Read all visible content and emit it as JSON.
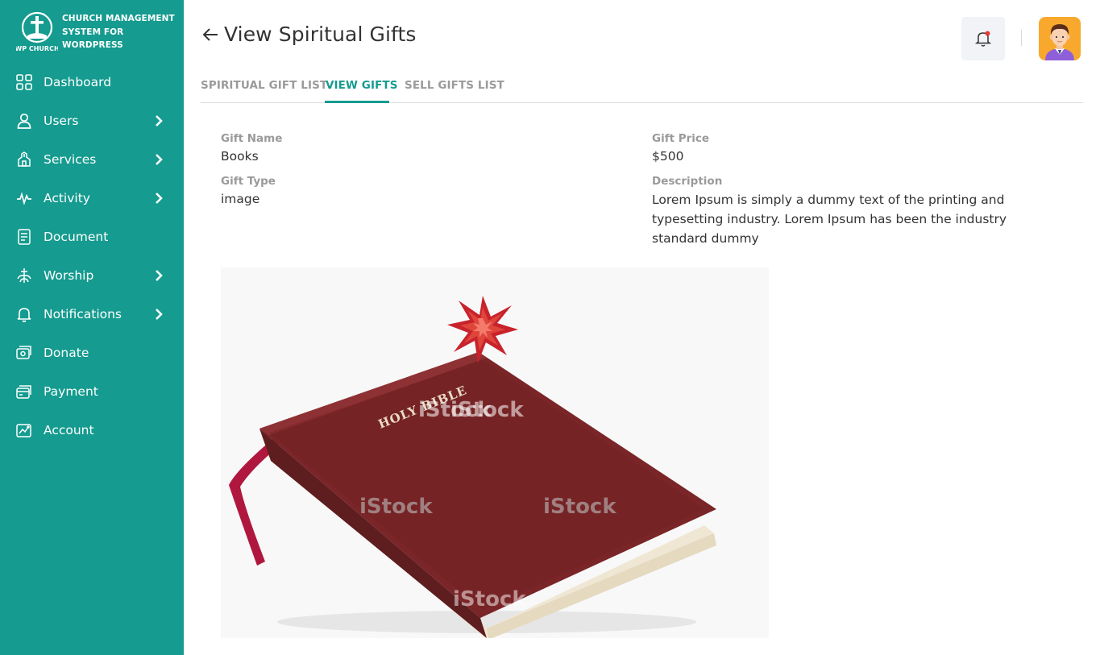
{
  "brand": {
    "logo_text": "WP CHURCH",
    "line1": "CHURCH MANAGEMENT",
    "line2": "SYSTEM FOR",
    "line3": "WORDPRESS"
  },
  "sidebar": {
    "items": [
      {
        "label": "Dashboard",
        "icon": "dashboard-icon",
        "has_children": false
      },
      {
        "label": "Users",
        "icon": "user-icon",
        "has_children": true
      },
      {
        "label": "Services",
        "icon": "services-icon",
        "has_children": true
      },
      {
        "label": "Activity",
        "icon": "activity-icon",
        "has_children": true
      },
      {
        "label": "Document",
        "icon": "document-icon",
        "has_children": false
      },
      {
        "label": "Worship",
        "icon": "worship-icon",
        "has_children": true
      },
      {
        "label": "Notifications",
        "icon": "bell-icon",
        "has_children": true
      },
      {
        "label": "Donate",
        "icon": "donate-icon",
        "has_children": false
      },
      {
        "label": "Payment",
        "icon": "payment-icon",
        "has_children": false
      },
      {
        "label": "Account",
        "icon": "account-icon",
        "has_children": false
      }
    ]
  },
  "header": {
    "title": "View Spiritual Gifts"
  },
  "tabs": [
    {
      "label": "SPIRITUAL GIFT LIST",
      "active": false
    },
    {
      "label": "VIEW GIFTS",
      "active": true
    },
    {
      "label": "SELL GIFTS LIST",
      "active": false
    }
  ],
  "gift": {
    "name_label": "Gift Name",
    "name": "Books",
    "price_label": "Gift Price",
    "price": "$500",
    "type_label": "Gift Type",
    "type": "image",
    "description_label": "Description",
    "description": "Lorem Ipsum is simply a dummy text of the printing and typesetting industry. Lorem Ipsum has been the industry standard dummy"
  },
  "image": {
    "book_title": "HOLY BIBLE",
    "watermark": "iStock"
  },
  "colors": {
    "primary": "#159b8f",
    "muted": "#9a9a9a",
    "notification_dot": "#e53935"
  }
}
